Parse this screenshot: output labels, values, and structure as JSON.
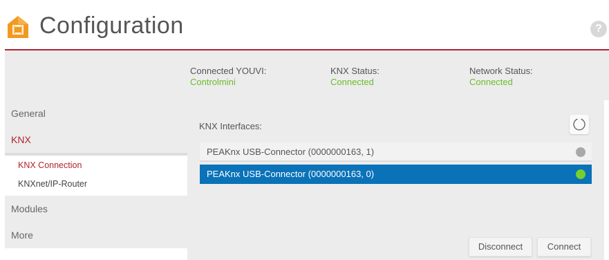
{
  "header": {
    "title": "Configuration",
    "help_label": "?",
    "accent_color": "#b0232e",
    "logo_icon": "house-logo-icon"
  },
  "status": {
    "youvi_label": "Connected YOUVI:",
    "youvi_value": "Controlmini",
    "knx_label": "KNX Status:",
    "knx_value": "Connected",
    "network_label": "Network Status:",
    "network_value": "Connected",
    "value_color": "#6dbb2c"
  },
  "sidebar": {
    "general": "General",
    "knx": "KNX",
    "knx_connection": "KNX Connection",
    "knxnet_router": "KNXnet/IP-Router",
    "modules": "Modules",
    "more": "More"
  },
  "main": {
    "interfaces_label": "KNX Interfaces:",
    "refresh_icon": "refresh-icon",
    "interfaces": [
      {
        "name": "PEAKnx USB-Connector (0000000163, 1)",
        "status_color": "#a9a9a9",
        "selected": false
      },
      {
        "name": "PEAKnx USB-Connector (0000000163, 0)",
        "status_color": "#74d02c",
        "selected": true
      }
    ],
    "disconnect_label": "Disconnect",
    "connect_label": "Connect"
  }
}
